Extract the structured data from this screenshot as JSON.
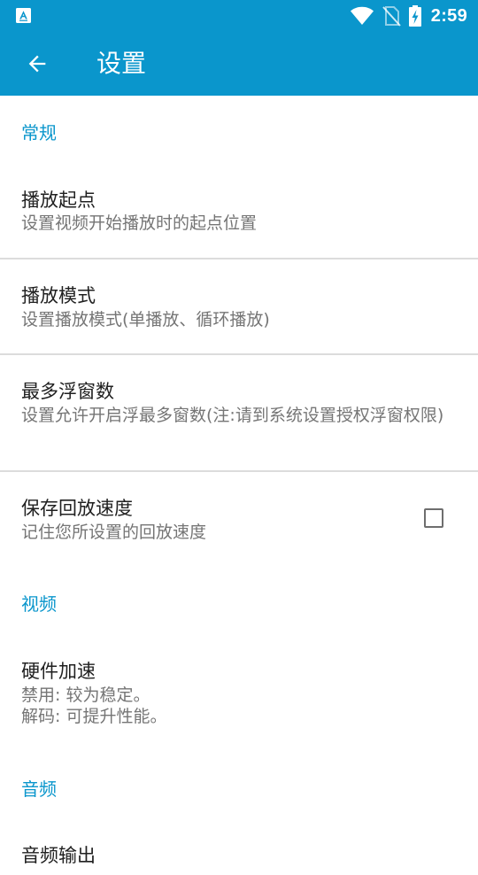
{
  "status_bar": {
    "time": "2:59",
    "icons": [
      "app-notification-icon",
      "wifi-icon",
      "no-sim-icon",
      "battery-charging-icon"
    ]
  },
  "app_bar": {
    "back_icon": "arrow-left-icon",
    "title": "设置"
  },
  "sections": [
    {
      "header": "常规",
      "items": [
        {
          "title": "播放起点",
          "summary": "设置视频开始播放时的起点位置"
        },
        {
          "title": "播放模式",
          "summary": "设置播放模式(单播放、循环播放)"
        },
        {
          "title": "最多浮窗数",
          "summary": "设置允许开启浮最多窗数(注:请到系统设置授权浮窗权限)"
        },
        {
          "title": "保存回放速度",
          "summary": "记住您所设置的回放速度",
          "checkbox": {
            "checked": false
          }
        }
      ]
    },
    {
      "header": "视频",
      "items": [
        {
          "title": "硬件加速",
          "summary_lines": [
            "禁用: 较为稳定。",
            "解码: 可提升性能。"
          ]
        }
      ]
    },
    {
      "header": "音频",
      "items": [
        {
          "title": "音频输出"
        }
      ]
    }
  ],
  "colors": {
    "primary": "#0a96cc",
    "title_text": "#202020",
    "summary_text": "#757575",
    "divider": "#dcdcdc"
  }
}
